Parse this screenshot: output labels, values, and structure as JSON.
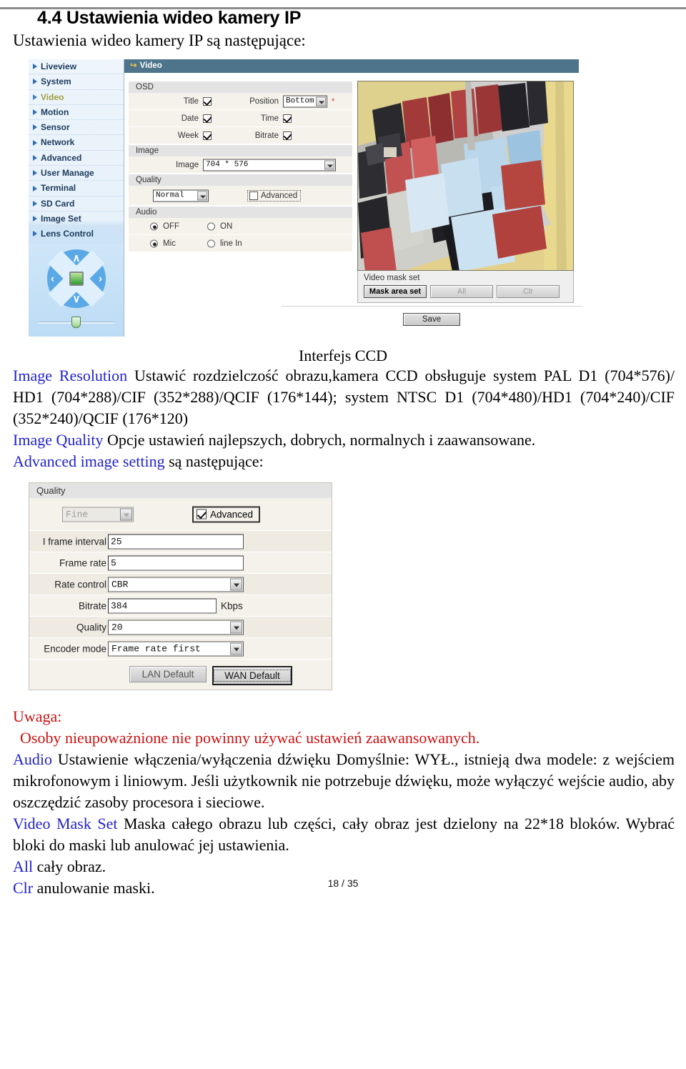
{
  "heading": {
    "number_title": "4.4 Ustawienia wideo kamery IP",
    "subtitle": "Ustawienia wideo kamery IP są następujące:"
  },
  "camera_ui": {
    "sidebar": {
      "items": [
        {
          "label": "Liveview",
          "active": false
        },
        {
          "label": "System",
          "active": false
        },
        {
          "label": "Video",
          "active": true
        },
        {
          "label": "Motion",
          "active": false
        },
        {
          "label": "Sensor",
          "active": false
        },
        {
          "label": "Network",
          "active": false
        },
        {
          "label": "Advanced",
          "active": false
        },
        {
          "label": "User Manage",
          "active": false
        },
        {
          "label": "Terminal",
          "active": false
        },
        {
          "label": "SD Card",
          "active": false
        },
        {
          "label": "Image Set",
          "active": false
        },
        {
          "label": "Lens Control",
          "active": false
        }
      ],
      "ptz": {
        "up": "∧",
        "down": "∨",
        "left": "‹",
        "right": "›"
      }
    },
    "page_header": "Video",
    "osd": {
      "group_label": "OSD",
      "title_label": "Title",
      "title_checked": true,
      "position_label": "Position",
      "position_value": "Bottom",
      "required_mark": "*",
      "date_label": "Date",
      "date_checked": true,
      "time_label": "Time",
      "time_checked": true,
      "week_label": "Week",
      "week_checked": true,
      "bitrate_label": "Bitrate",
      "bitrate_checked": true
    },
    "image": {
      "group_label": "Image",
      "field_label": "Image",
      "value": "704 * 576"
    },
    "quality": {
      "group_label": "Quality",
      "value": "Normal",
      "advanced_label": "Advanced",
      "advanced_checked": false
    },
    "audio": {
      "group_label": "Audio",
      "off_label": "OFF",
      "on_label": "ON",
      "mic_label": "Mic",
      "linein_label": "line In",
      "power_selected": "OFF",
      "input_selected": "Mic"
    },
    "video_mask": {
      "title": "Video mask set",
      "mask_area_set": "Mask area set",
      "all": "All",
      "clr": "Clr"
    },
    "save_label": "Save"
  },
  "caption_ccd": "Interfejs CCD",
  "body": {
    "image_resolution_kw": "Image Resolution",
    "image_resolution_text": " Ustawić rozdzielczość obrazu,kamera CCD obsługuje system PAL D1 (704*576)/ HD1 (704*288)/CIF (352*288)/QCIF (176*144); system NTSC D1 (704*480)/HD1 (704*240)/CIF (352*240)/QCIF (176*120)",
    "image_quality_kw": "Image Quality",
    "image_quality_text": " Opcje ustawień najlepszych, dobrych, normalnych i zaawansowane.",
    "advanced_image_kw": "Advanced image setting",
    "advanced_image_text": " są następujące:",
    "uwaga_label": "Uwaga:",
    "uwaga_text": "Osoby nieupoważnione nie powinny używać ustawień zaawansowanych.",
    "audio_kw": "Audio",
    "audio_text": " Ustawienie włączenia/wyłączenia dźwięku  Domyślnie: WYŁ., istnieją dwa modele: z wejściem mikrofonowym i liniowym. Jeśli użytkownik nie potrzebuje dźwięku, może wyłączyć wejście audio, aby oszczędzić zasoby procesora i sieciowe.",
    "video_mask_kw": "Video Mask Set",
    "video_mask_text": " Maska całego obrazu lub części, cały obraz jest dzielony na 22*18 bloków. Wybrać bloki do maski lub anulować jej ustawienia.",
    "all_kw": "All",
    "all_text": " cały obraz.",
    "clr_kw": "Clr",
    "clr_text": " anulowanie maski."
  },
  "quality_dialog": {
    "group_label": "Quality",
    "preset_value": "Fine",
    "advanced_label": "Advanced",
    "advanced_checked": true,
    "rows": [
      {
        "label": "I frame interval",
        "value": "25",
        "unit": ""
      },
      {
        "label": "Frame rate",
        "value": "5",
        "unit": ""
      },
      {
        "label": "Rate control",
        "value": "CBR",
        "unit": ""
      },
      {
        "label": "Bitrate",
        "value": "384",
        "unit": "Kbps"
      },
      {
        "label": "Quality",
        "value": "20",
        "unit": ""
      },
      {
        "label": "Encoder mode",
        "value": "Frame rate first",
        "unit": ""
      }
    ],
    "lan_default": "LAN Default",
    "wan_default": "WAN Default"
  },
  "footer": "18 / 35",
  "colors": {
    "header_blue": "#4d748b",
    "keyword_blue": "#2222cc",
    "warning_red": "#cc1111",
    "active_nav": "#9d9d3d"
  }
}
